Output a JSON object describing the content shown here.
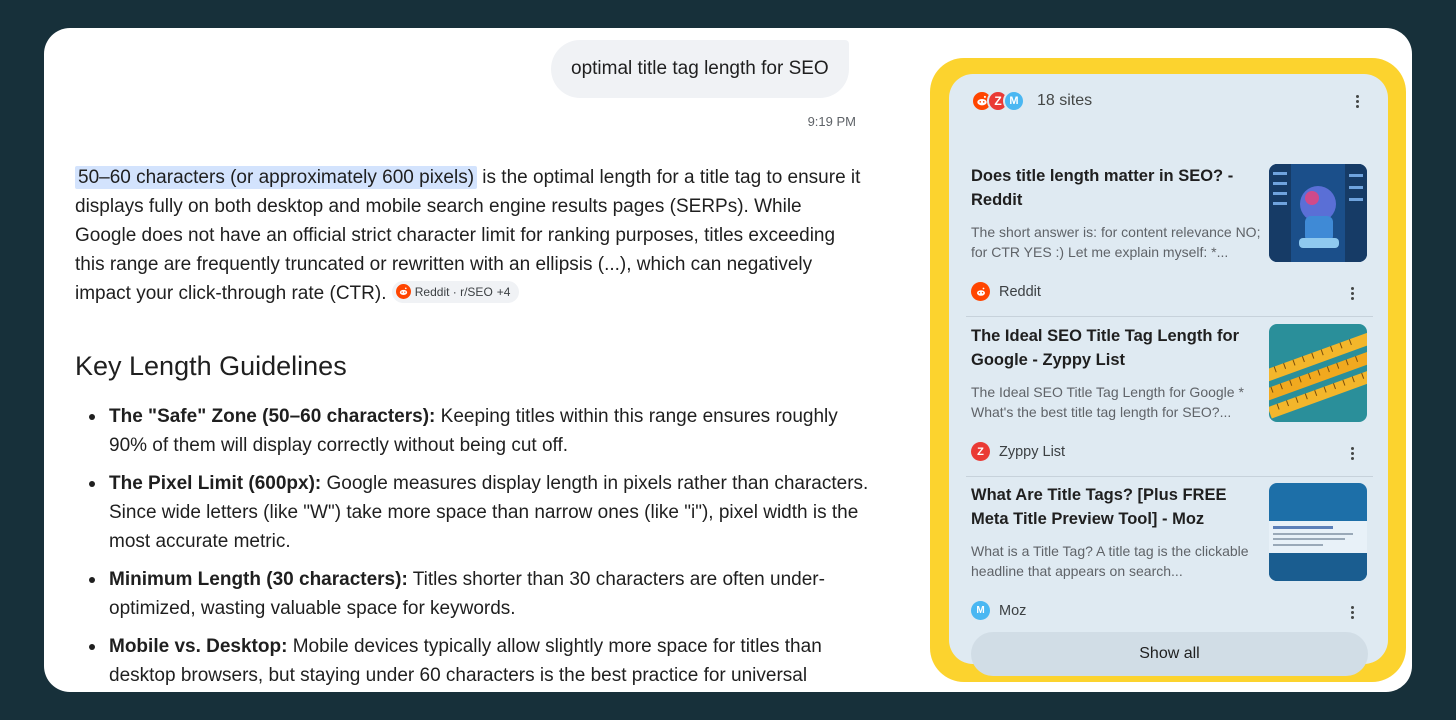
{
  "query": {
    "text": "optimal title tag length for SEO",
    "time": "9:19 PM"
  },
  "answer": {
    "highlight": "50–60 characters (or approximately 600 pixels)",
    "body": " is the optimal length for a title tag to ensure it displays fully on both desktop and mobile search engine results pages (SERPs). While Google does not have an official strict character limit for ranking purposes, titles exceeding this range are frequently truncated or rewritten with an ellipsis (...), which can negatively impact your click-through rate (CTR). ",
    "citation": {
      "label": "Reddit · r/SEO",
      "more": "+4"
    }
  },
  "section": {
    "heading": "Key Length Guidelines"
  },
  "guidelines": [
    {
      "term": "The \"Safe\" Zone (50–60 characters):",
      "text": " Keeping titles within this range ensures roughly 90% of them will display correctly without being cut off."
    },
    {
      "term": "The Pixel Limit (600px):",
      "text": " Google measures display length in pixels rather than characters. Since wide letters (like \"W\") take more space than narrow ones (like \"i\"), pixel width is the most accurate metric."
    },
    {
      "term": "Minimum Length (30 characters):",
      "text": " Titles shorter than 30 characters are often under-optimized, wasting valuable space for keywords."
    },
    {
      "term": "Mobile vs. Desktop:",
      "text": " Mobile devices typically allow slightly more space for titles than desktop browsers, but staying under 60 characters is the best practice for universal"
    }
  ],
  "sources": {
    "count_label": "18 sites",
    "items": [
      {
        "title": "Does title length matter in SEO? - Reddit",
        "snippet": "The short answer is: for content relevance NO; for CTR YES :) Let me explain myself: *...",
        "site": "Reddit",
        "icon": "reddit-logo"
      },
      {
        "title": "The Ideal SEO Title Tag Length for Google - Zyppy List",
        "snippet": "The Ideal SEO Title Tag Length for Google * What's the best title tag length for SEO?...",
        "site": "Zyppy List",
        "icon": "zyppy-logo"
      },
      {
        "title": "What Are Title Tags? [Plus FREE Meta Title Preview Tool] - Moz",
        "snippet": "What is a Title Tag? A title tag is the clickable headline that appears on search...",
        "site": "Moz",
        "icon": "moz-logo"
      }
    ],
    "show_all": "Show all"
  },
  "colors": {
    "page_background": "#17303a",
    "highlight": "#d3e3fd",
    "panel_border": "#fcd32e",
    "panel_background": "#dfeaf2",
    "reddit": "#ff4500",
    "zyppy": "#ea3a35",
    "moz": "#4ab7f2"
  }
}
